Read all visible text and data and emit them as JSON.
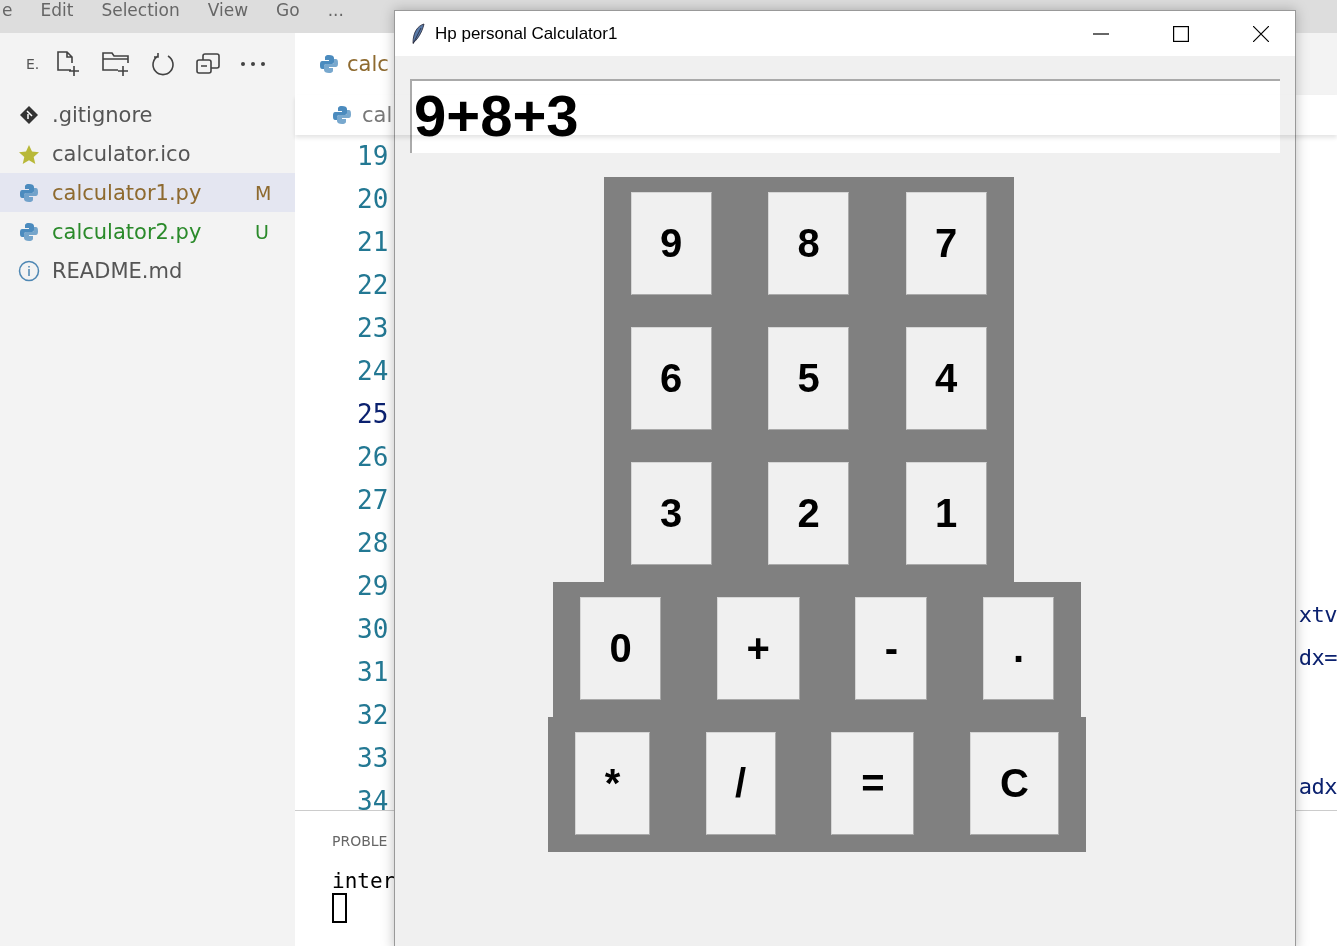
{
  "menu": [
    "e",
    "Edit",
    "Selection",
    "View",
    "Go",
    "..."
  ],
  "explorer": {
    "title": "E.",
    "files": [
      {
        "name": ".gitignore",
        "kind": "git",
        "selected": false
      },
      {
        "name": "calculator.ico",
        "kind": "star",
        "selected": false
      },
      {
        "name": "calculator1.py",
        "kind": "python",
        "selected": true,
        "status": "M",
        "color": "#8e6a2f"
      },
      {
        "name": "calculator2.py",
        "kind": "python",
        "selected": false,
        "status": "U",
        "color": "#2a8a2a"
      },
      {
        "name": "README.md",
        "kind": "info",
        "selected": false
      }
    ]
  },
  "editor": {
    "tab": "calc",
    "breadcrumb": "cal",
    "line_numbers": [
      {
        "text": "19",
        "current": false
      },
      {
        "text": "20",
        "current": false
      },
      {
        "text": "21",
        "current": false
      },
      {
        "text": "22",
        "current": false
      },
      {
        "text": "23",
        "current": false
      },
      {
        "text": "24",
        "current": false
      },
      {
        "text": "25",
        "current": true
      },
      {
        "text": "26",
        "current": false
      },
      {
        "text": "27",
        "current": false
      },
      {
        "text": "28",
        "current": false
      },
      {
        "text": "29",
        "current": false
      },
      {
        "text": "30",
        "current": false
      },
      {
        "text": "31",
        "current": false
      },
      {
        "text": "32",
        "current": false
      },
      {
        "text": "33",
        "current": false
      },
      {
        "text": "34",
        "current": false
      }
    ],
    "code_fragments": [
      {
        "text": "xtv"
      },
      {
        "text": "dx="
      },
      {
        "text": "adx"
      }
    ]
  },
  "panel": {
    "tab": "PROBLE",
    "terminal": "inter"
  },
  "calculator": {
    "title": "Hp personal Calculator1",
    "display": "9+8+3",
    "key_rows": [
      [
        "9",
        "8",
        "7"
      ],
      [
        "6",
        "5",
        "4"
      ],
      [
        "3",
        "2",
        "1"
      ],
      [
        "0",
        "+",
        "-",
        "."
      ],
      [
        "*",
        "/",
        "=",
        "C"
      ]
    ]
  }
}
